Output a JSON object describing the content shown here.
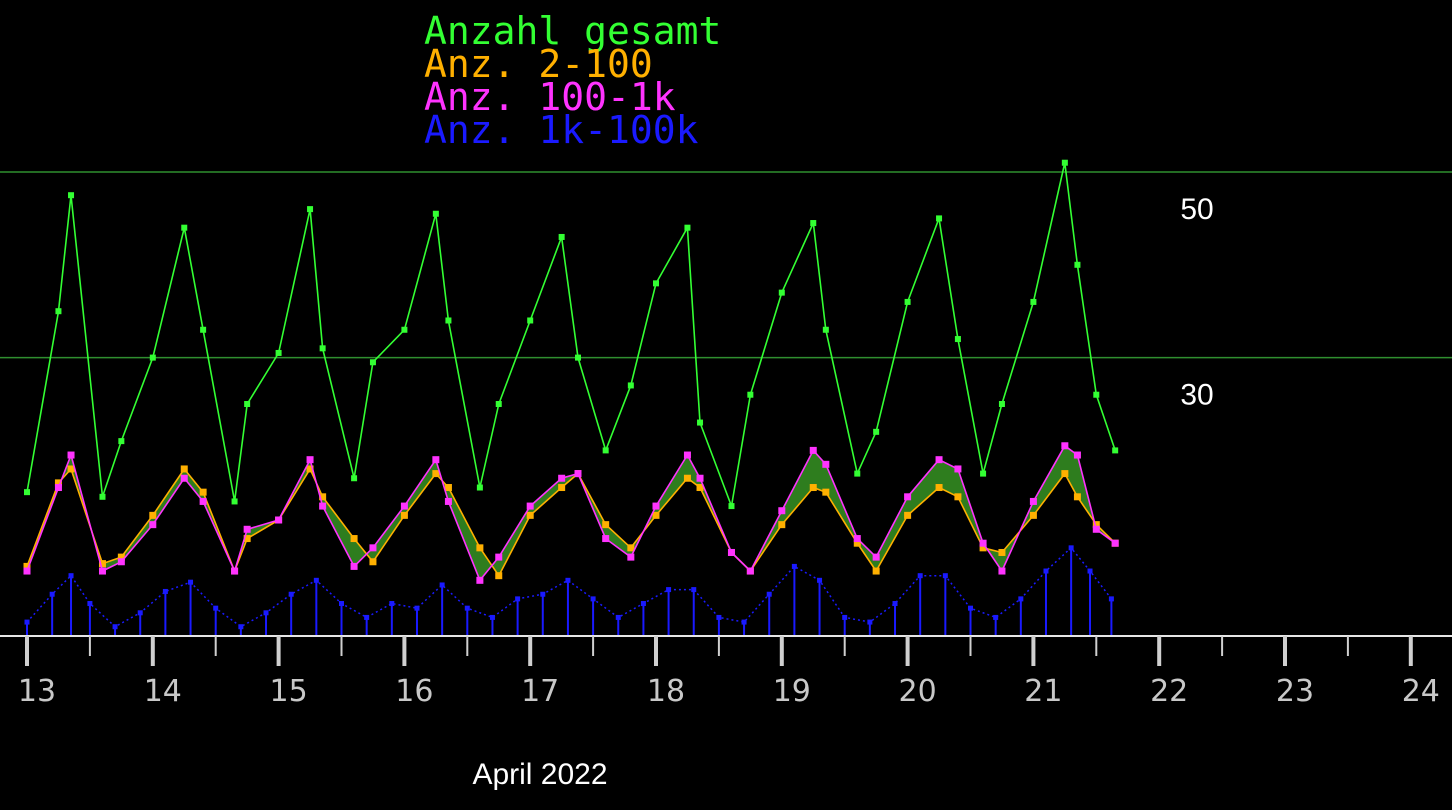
{
  "chart_data": {
    "type": "line",
    "xlabel": "April 2022",
    "ylabel": "",
    "x_ticks": [
      "13",
      "14",
      "15",
      "16",
      "17",
      "18",
      "19",
      "20",
      "21",
      "22",
      "23",
      "24"
    ],
    "x_range": [
      13,
      24
    ],
    "y_ticks": [
      30,
      50
    ],
    "ylim": [
      0,
      58
    ],
    "grid": "horizontal lines at 30 and 50",
    "legend_position": "top-center",
    "series": [
      {
        "name": "Anzahl gesamt",
        "color": "#33ff33",
        "style": "line-with-markers",
        "x": [
          13.0,
          13.25,
          13.35,
          13.6,
          13.75,
          14.0,
          14.25,
          14.4,
          14.65,
          14.75,
          15.0,
          15.25,
          15.35,
          15.6,
          15.75,
          16.0,
          16.25,
          16.35,
          16.6,
          16.75,
          17.0,
          17.25,
          17.38,
          17.6,
          17.8,
          18.0,
          18.25,
          18.35,
          18.6,
          18.75,
          19.0,
          19.25,
          19.35,
          19.6,
          19.75,
          20.0,
          20.25,
          20.4,
          20.6,
          20.75,
          21.0,
          21.25,
          21.35,
          21.5,
          21.65
        ],
        "y": [
          15.5,
          35.0,
          47.5,
          15.0,
          21.0,
          30.0,
          44.0,
          33.0,
          14.5,
          25.0,
          30.5,
          46.0,
          31.0,
          17.0,
          29.5,
          33.0,
          45.5,
          34.0,
          16.0,
          25.0,
          34.0,
          43.0,
          30.0,
          20.0,
          27.0,
          38.0,
          44.0,
          23.0,
          14.0,
          26.0,
          37.0,
          44.5,
          33.0,
          17.5,
          22.0,
          36.0,
          45.0,
          32.0,
          17.5,
          25.0,
          36.0,
          51.0,
          40.0,
          26.0,
          20.0
        ]
      },
      {
        "name": "Anz. 2-100",
        "color": "#ffb000",
        "style": "line-with-markers",
        "x": [
          13.0,
          13.25,
          13.35,
          13.6,
          13.75,
          14.0,
          14.25,
          14.4,
          14.65,
          14.75,
          15.0,
          15.25,
          15.35,
          15.6,
          15.75,
          16.0,
          16.25,
          16.35,
          16.6,
          16.75,
          17.0,
          17.25,
          17.38,
          17.6,
          17.8,
          18.0,
          18.25,
          18.35,
          18.6,
          18.75,
          19.0,
          19.25,
          19.35,
          19.6,
          19.75,
          20.0,
          20.25,
          20.4,
          20.6,
          20.75,
          21.0,
          21.25,
          21.35,
          21.5,
          21.65
        ],
        "y": [
          7.5,
          16.5,
          18.0,
          7.8,
          8.5,
          13.0,
          18.0,
          15.5,
          7.0,
          10.5,
          12.5,
          18.0,
          15.0,
          10.5,
          8.0,
          13.0,
          17.5,
          16.0,
          9.5,
          6.5,
          13.0,
          16.0,
          17.5,
          12.0,
          9.5,
          13.0,
          17.0,
          16.0,
          9.0,
          7.0,
          12.0,
          16.0,
          15.5,
          10.0,
          7.0,
          13.0,
          16.0,
          15.0,
          9.5,
          9.0,
          13.0,
          17.5,
          15.0,
          12.0,
          10.0
        ]
      },
      {
        "name": "Anz. 100-1k",
        "color": "#ff33ff",
        "style": "line-with-markers",
        "x": [
          13.0,
          13.25,
          13.35,
          13.6,
          13.75,
          14.0,
          14.25,
          14.4,
          14.65,
          14.75,
          15.0,
          15.25,
          15.35,
          15.6,
          15.75,
          16.0,
          16.25,
          16.35,
          16.6,
          16.75,
          17.0,
          17.25,
          17.38,
          17.6,
          17.8,
          18.0,
          18.25,
          18.35,
          18.6,
          18.75,
          19.0,
          19.25,
          19.35,
          19.6,
          19.75,
          20.0,
          20.25,
          20.4,
          20.6,
          20.75,
          21.0,
          21.25,
          21.35,
          21.5,
          21.65
        ],
        "y": [
          7.0,
          16.0,
          19.5,
          7.0,
          8.0,
          12.0,
          17.0,
          14.5,
          7.0,
          11.5,
          12.5,
          19.0,
          14.0,
          7.5,
          9.5,
          14.0,
          19.0,
          14.5,
          6.0,
          8.5,
          14.0,
          17.0,
          17.5,
          10.5,
          8.5,
          14.0,
          19.5,
          17.0,
          9.0,
          7.0,
          13.5,
          20.0,
          18.5,
          10.5,
          8.5,
          15.0,
          19.0,
          18.0,
          10.0,
          7.0,
          14.5,
          20.5,
          19.5,
          11.5,
          10.0
        ]
      },
      {
        "name": "Anz. 1k-100k",
        "color": "#1a1aff",
        "style": "stems-with-markers",
        "x": [
          13.0,
          13.2,
          13.35,
          13.5,
          13.7,
          13.9,
          14.1,
          14.3,
          14.5,
          14.7,
          14.9,
          15.1,
          15.3,
          15.5,
          15.7,
          15.9,
          16.1,
          16.3,
          16.5,
          16.7,
          16.9,
          17.1,
          17.3,
          17.5,
          17.7,
          17.9,
          18.1,
          18.3,
          18.5,
          18.7,
          18.9,
          19.1,
          19.3,
          19.5,
          19.7,
          19.9,
          20.1,
          20.3,
          20.5,
          20.7,
          20.9,
          21.1,
          21.3,
          21.45,
          21.62
        ],
        "y": [
          1.5,
          4.5,
          6.5,
          3.5,
          1.0,
          2.5,
          4.8,
          5.8,
          3.0,
          1.0,
          2.5,
          4.5,
          6.0,
          3.5,
          2.0,
          3.5,
          3.0,
          5.5,
          3.0,
          2.0,
          4.0,
          4.5,
          6.0,
          4.0,
          2.0,
          3.5,
          5.0,
          5.0,
          2.0,
          1.5,
          4.5,
          7.5,
          6.0,
          2.0,
          1.5,
          3.5,
          6.5,
          6.5,
          3.0,
          2.0,
          4.0,
          7.0,
          9.5,
          7.0,
          4.0
        ]
      }
    ]
  }
}
